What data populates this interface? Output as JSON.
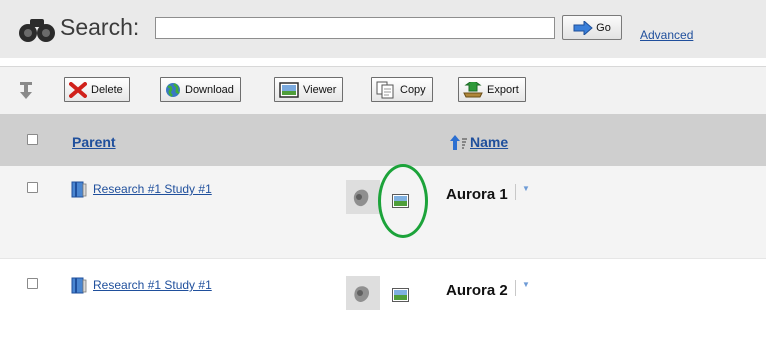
{
  "search": {
    "label": "Search:",
    "value": "",
    "placeholder": "",
    "go_label": "Go",
    "advanced_label": "Advanced"
  },
  "toolbar": {
    "buttons": [
      {
        "label": "Delete",
        "icon": "delete-x-icon"
      },
      {
        "label": "Download",
        "icon": "globe-icon"
      },
      {
        "label": "Viewer",
        "icon": "image-viewer-icon"
      },
      {
        "label": "Copy",
        "icon": "copy-pages-icon"
      },
      {
        "label": "Export",
        "icon": "export-tray-icon"
      }
    ]
  },
  "table": {
    "headers": {
      "parent": "Parent",
      "name": "Name"
    },
    "rows": [
      {
        "parent": "Research #1 Study #1",
        "name": "Aurora 1"
      },
      {
        "parent": "Research #1 Study #1",
        "name": "Aurora 2"
      }
    ]
  },
  "colors": {
    "link": "#1f4f9c",
    "header_bg": "#cfcfcf",
    "annotation": "#1ca33a"
  }
}
